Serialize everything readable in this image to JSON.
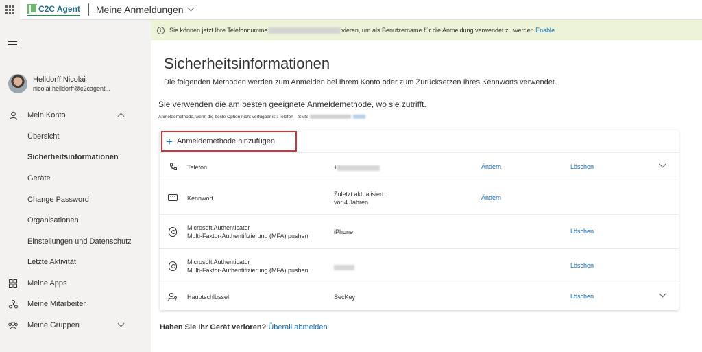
{
  "header": {
    "logo_text": "C2C Agent",
    "app_title": "Meine Anmeldungen"
  },
  "sidebar": {
    "profile": {
      "name": "Helldorff Nicolai",
      "email": "nicolai.helldorff@c2cagent..."
    },
    "items": [
      {
        "label": "Mein Konto",
        "icon": "person-icon"
      },
      {
        "label": "Übersicht"
      },
      {
        "label": "Sicherheitsinformationen"
      },
      {
        "label": "Geräte"
      },
      {
        "label": "Change Password"
      },
      {
        "label": "Organisationen"
      },
      {
        "label": "Einstellungen und Datenschutz"
      },
      {
        "label": "Letzte Aktivität"
      },
      {
        "label": "Meine Apps",
        "icon": "apps-icon"
      },
      {
        "label": "Meine Mitarbeiter",
        "icon": "people-icon"
      },
      {
        "label": "Meine Gruppen",
        "icon": "groups-icon"
      }
    ]
  },
  "banner": {
    "text_before": "Sie können jetzt Ihre Telefonnumme",
    "text_after": "vieren, um als Benutzername für die Anmeldung verwendet zu werden.",
    "link": "Enable"
  },
  "main": {
    "title": "Sicherheitsinformationen",
    "description": "Die folgenden Methoden werden zum Anmelden bei Ihrem Konto oder zum Zurücksetzen Ihres Kennworts verwendet.",
    "default_line": "Sie verwenden die am besten geeignete Anmeldemethode, wo sie zutrifft.",
    "default_sub": "Anmeldemethode, wenn die beste Option nicht verfügbar ist: Telefon – SMS",
    "add_method": "Anmeldemethode hinzufügen",
    "change_label": "Ändern",
    "delete_label": "Löschen",
    "methods": [
      {
        "name": "Telefon",
        "value": "+"
      },
      {
        "name": "Kennwort",
        "value": "Zuletzt aktualisiert:",
        "value2": "vor 4 Jahren"
      },
      {
        "name": "Microsoft Authenticator",
        "sub": "Multi-Faktor-Authentifizierung (MFA) pushen",
        "value": "iPhone"
      },
      {
        "name": "Microsoft Authenticator",
        "sub": "Multi-Faktor-Authentifizierung (MFA) pushen",
        "value": ""
      },
      {
        "name": "Hauptschlüssel",
        "value": "SecKey"
      }
    ],
    "lost_question": "Haben Sie Ihr Gerät verloren?",
    "lost_link": "Überall abmelden"
  }
}
